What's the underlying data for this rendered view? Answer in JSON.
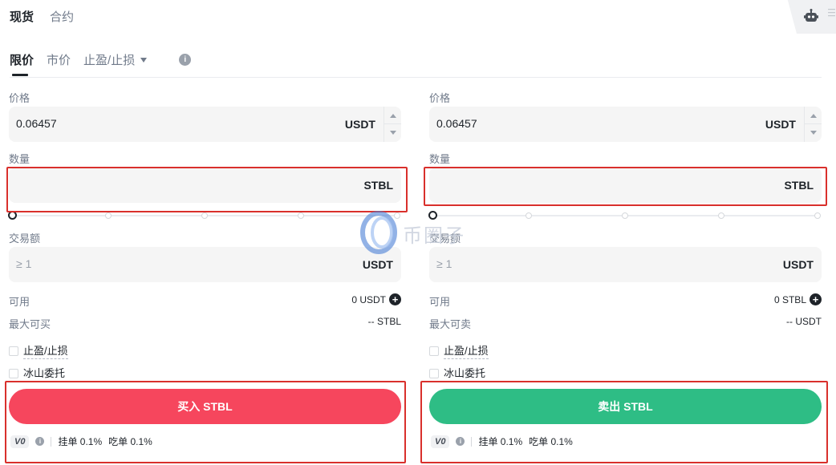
{
  "top_tabs": [
    "现货",
    "合约"
  ],
  "order_tabs": {
    "limit": "限价",
    "market": "市价",
    "tpsl": "止盈/止损"
  },
  "buy": {
    "price_label": "价格",
    "price_value": "0.06457",
    "price_unit": "USDT",
    "qty_label": "数量",
    "qty_value": "",
    "qty_unit": "STBL",
    "total_label": "交易额",
    "total_placeholder": "≥ 1",
    "total_unit": "USDT",
    "avail_label": "可用",
    "avail_value": "0 USDT",
    "max_label": "最大可买",
    "max_value": "-- STBL",
    "tpsl_label": "止盈/止损",
    "iceberg_label": "冰山委托",
    "button": "买入 STBL",
    "vip": "V0",
    "maker_fee": "挂单 0.1%",
    "taker_fee": "吃单 0.1%"
  },
  "sell": {
    "price_label": "价格",
    "price_value": "0.06457",
    "price_unit": "USDT",
    "qty_label": "数量",
    "qty_value": "",
    "qty_unit": "STBL",
    "total_label": "交易额",
    "total_placeholder": "≥ 1",
    "total_unit": "USDT",
    "avail_label": "可用",
    "avail_value": "0 STBL",
    "max_label": "最大可卖",
    "max_value": "-- USDT",
    "tpsl_label": "止盈/止损",
    "iceberg_label": "冰山委托",
    "button": "卖出 STBL",
    "vip": "V0",
    "maker_fee": "挂单 0.1%",
    "taker_fee": "吃单 0.1%"
  },
  "watermark": "币圈子",
  "colors": {
    "buy": "#f6465d",
    "sell": "#2ebd85",
    "highlight": "#d9302c",
    "field_bg": "#f5f5f5"
  },
  "icons": [
    "robot-icon",
    "info-icon",
    "plus-icon",
    "chevron-down-icon",
    "stepper-up-icon",
    "stepper-down-icon"
  ]
}
